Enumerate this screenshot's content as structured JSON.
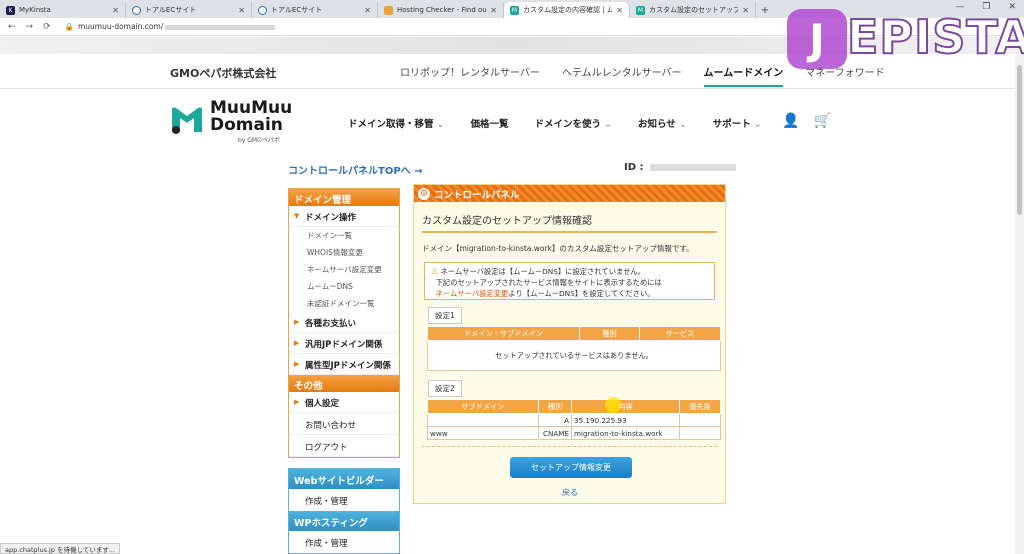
{
  "browser": {
    "tabs": [
      {
        "title": "MyKinsta",
        "icon": "kinsta-icon"
      },
      {
        "title": "トアルECサイト",
        "icon": "wordpress-icon"
      },
      {
        "title": "トアルECサイト",
        "icon": "wordpress-icon"
      },
      {
        "title": "Hosting Checker - Find out who",
        "icon": "hosting-checker-icon"
      },
      {
        "title": "カスタム設定の内容確認 | ムームード",
        "icon": "muumuu-icon",
        "active": true
      },
      {
        "title": "カスタム設定のセットアップ方法 | ムー",
        "icon": "muumuu-icon"
      }
    ],
    "url": "muumuu-domain.com/"
  },
  "watermark": {
    "badge": "J",
    "text": "EPISTA"
  },
  "gmo_header": {
    "logo": "GMOペパボ株式会社",
    "links": [
      "ロリポップ！レンタルサーバー",
      "ヘテムルレンタルサーバー",
      "ムームードメイン",
      "マネーフォワード"
    ]
  },
  "site": {
    "logo_line1": "MuuMuu",
    "logo_line2": "Domain",
    "logo_sub": "by GMOペパボ",
    "nav": [
      "ドメイン取得・移管",
      "価格一覧",
      "ドメインを使う",
      "お知らせ",
      "サポート"
    ]
  },
  "cp_top_link": "コントロールパネルTOPへ →",
  "user_id_label": "ID :",
  "sidebar": {
    "domain_head": "ドメイン管理",
    "domain_ops": "ドメイン操作",
    "sub_items": [
      "ドメイン一覧",
      "WHOIS情報変更",
      "ネームサーバ設定変更",
      "ムームーDNS",
      "未認証ドメイン一覧"
    ],
    "items": [
      "各種お支払い",
      "汎用JPドメイン関係",
      "属性型JPドメイン関係"
    ],
    "other_head": "その他",
    "other_items": [
      "個人設定",
      "お問い合わせ",
      "ログアウト"
    ],
    "web_head": "Webサイトビルダー",
    "web_item": "作成・管理",
    "wp_head": "WPホスティング",
    "wp_item": "作成・管理"
  },
  "panel": {
    "head": "コントロールパネル",
    "title": "カスタム設定のセットアップ情報確認",
    "desc": "ドメイン【migration-to-kinsta.work】のカスタム設定セットアップ情報です。",
    "notice_line1": "ネームサーバ設定は【ムームーDNS】に設定されていません。",
    "notice_line2": "下記のセットアップされたサービス情報をサイトに表示するためには",
    "notice_link": "ネームサーバ設定変更",
    "notice_line3": "より【ムームーDNS】を設定してください。",
    "setting1_label": "設定1",
    "setting1_headers": [
      "ドメイン・サブドメイン",
      "種別",
      "サービス"
    ],
    "setting1_empty": "セットアップされているサービスはありません。",
    "setting2_label": "設定2",
    "setting2_headers": [
      "サブドメイン",
      "種別",
      "内容",
      "優先度"
    ],
    "setting2_rows": [
      [
        "",
        "A",
        "35.190.225.93",
        ""
      ],
      [
        "www",
        "CNAME",
        "migration-to-kinsta.work",
        ""
      ]
    ],
    "button": "セットアップ情報変更",
    "back": "戻る"
  },
  "status_text": "app.chatplus.jp を待機しています..."
}
